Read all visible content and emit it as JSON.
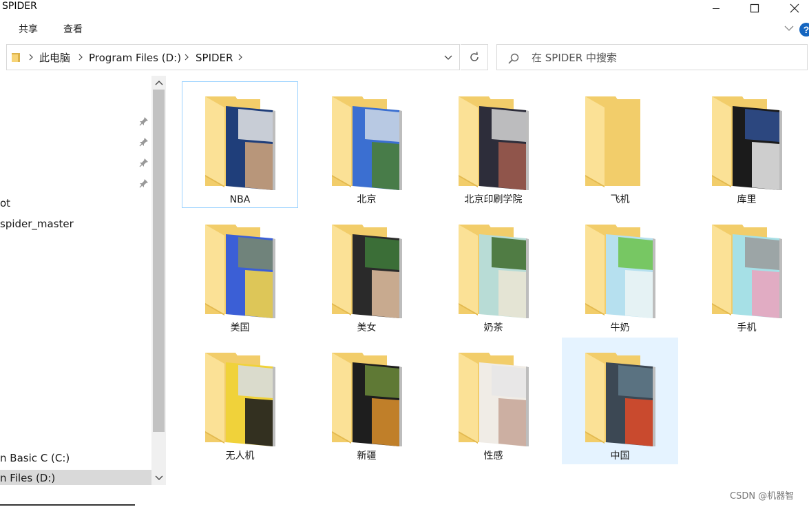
{
  "window": {
    "title": "SPIDER"
  },
  "ribbon": {
    "tabs": [
      "共享",
      "查看"
    ]
  },
  "address": {
    "breadcrumbs": [
      "此电脑",
      "Program Files (D:)",
      "SPIDER"
    ]
  },
  "search": {
    "placeholder": "在 SPIDER 中搜索"
  },
  "nav": {
    "items": [
      {
        "label": "ot",
        "selected": false
      },
      {
        "label": "spider_master",
        "selected": false
      },
      {
        "label": "n Basic C (C:)",
        "selected": false
      },
      {
        "label": "n Files (D:)",
        "selected": true
      }
    ]
  },
  "folders": [
    {
      "name": "NBA",
      "thumb": [
        "#1f3e7a",
        "#c9a07a",
        "#e6e6e6"
      ],
      "state": "selected"
    },
    {
      "name": "北京",
      "thumb": [
        "#3b6fd1",
        "#4a7d3a",
        "#cfd9e6"
      ],
      "state": ""
    },
    {
      "name": "北京印刷学院",
      "thumb": [
        "#2d2d3a",
        "#9b5a4e",
        "#d6d6d6"
      ],
      "state": ""
    },
    {
      "name": "飞机",
      "thumb": [],
      "state": ""
    },
    {
      "name": "库里",
      "thumb": [
        "#1b1b1b",
        "#e2e2e2",
        "#2f4f90"
      ],
      "state": ""
    },
    {
      "name": "美国",
      "thumb": [
        "#3b5fd6",
        "#f0d24a",
        "#7a8a6b"
      ],
      "state": ""
    },
    {
      "name": "美女",
      "thumb": [
        "#2a2a2a",
        "#d9b89a",
        "#3e7a3a"
      ],
      "state": ""
    },
    {
      "name": "奶茶",
      "thumb": [
        "#b8dcd6",
        "#e9e4d4",
        "#3d6b2a"
      ],
      "state": ""
    },
    {
      "name": "牛奶",
      "thumb": [
        "#b6e0ef",
        "#eaf4f4",
        "#6cc24a"
      ],
      "state": ""
    },
    {
      "name": "手机",
      "thumb": [
        "#a6e0e6",
        "#e8a6bf",
        "#9a9a9a"
      ],
      "state": ""
    },
    {
      "name": "无人机",
      "thumb": [
        "#f0d23a",
        "#1e1e1e",
        "#d6dde6"
      ],
      "state": ""
    },
    {
      "name": "新疆",
      "thumb": [
        "#1e1e1e",
        "#d18a2a",
        "#6b8a3a"
      ],
      "state": ""
    },
    {
      "name": "性感",
      "thumb": [
        "#f0ece6",
        "#c8a89a",
        "#e6e6e6"
      ],
      "state": ""
    },
    {
      "name": "中国",
      "thumb": [
        "#3c4854",
        "#d84a2a",
        "#5f7a8a"
      ],
      "state": "hover"
    }
  ],
  "watermark": "CSDN @机器智",
  "colors": {
    "folder_back": "#f2cd6a",
    "folder_front": "#fbe196",
    "selection_border": "#99d1ff",
    "hover_bg": "#e5f3ff",
    "accent": "#1566c0"
  }
}
